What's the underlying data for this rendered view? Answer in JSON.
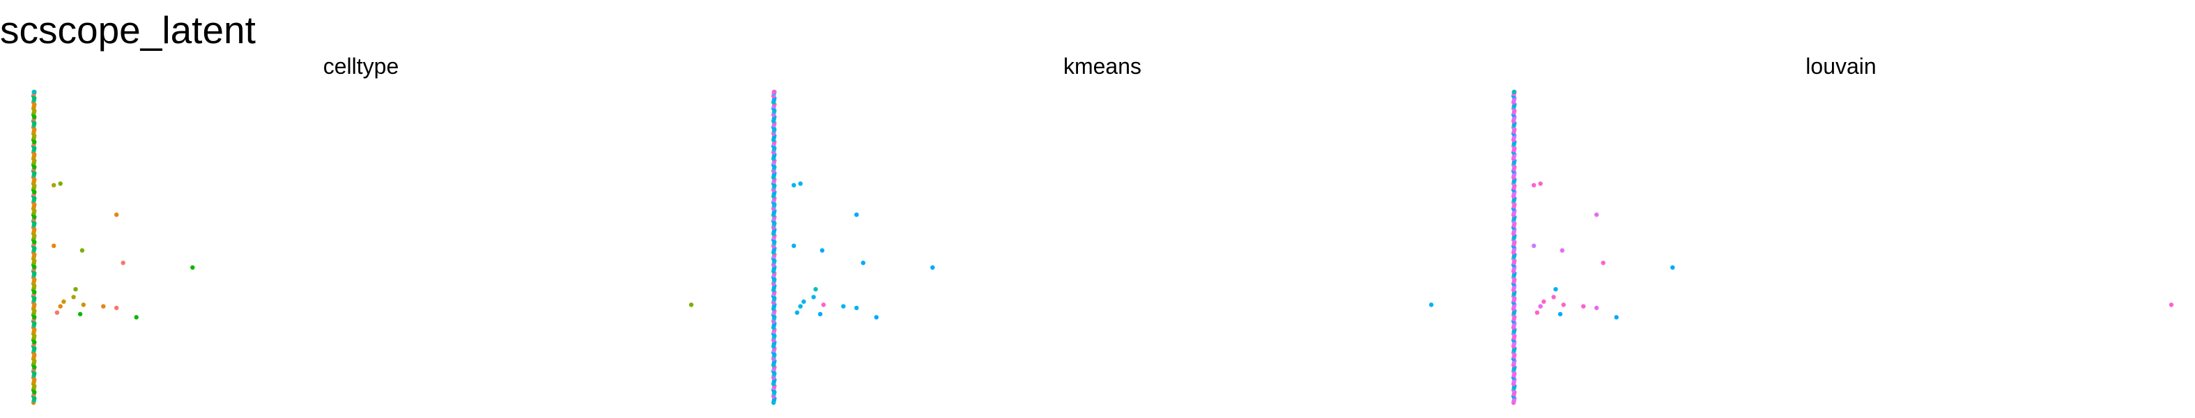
{
  "page_title": "scscope_latent",
  "chart_data": [
    {
      "type": "scatter",
      "title": "celltype",
      "xlabel": "",
      "ylabel": "",
      "xlim": [
        0,
        100
      ],
      "ylim": [
        0,
        100
      ],
      "grid": false,
      "legend": "none",
      "strip": {
        "x": 0.5,
        "y_range": [
          0,
          100
        ],
        "colors": [
          "#E68613",
          "#CD9600",
          "#ABA300",
          "#7CAE00",
          "#0CB702",
          "#F8766D",
          "#00BE67",
          "#00C19A"
        ],
        "top_point": {
          "y": 100,
          "color": "#00BFC4"
        }
      },
      "points": [
        {
          "x": 3.5,
          "y": 70,
          "color": "#ABA300"
        },
        {
          "x": 4.5,
          "y": 70.5,
          "color": "#7CAE00"
        },
        {
          "x": 13,
          "y": 60.5,
          "color": "#E68613"
        },
        {
          "x": 3.5,
          "y": 50.5,
          "color": "#E68613"
        },
        {
          "x": 7.8,
          "y": 49,
          "color": "#7CAE00"
        },
        {
          "x": 14,
          "y": 45,
          "color": "#F8766D"
        },
        {
          "x": 24.5,
          "y": 43.5,
          "color": "#0CB702"
        },
        {
          "x": 6.8,
          "y": 36.5,
          "color": "#7CAE00"
        },
        {
          "x": 6.5,
          "y": 34,
          "color": "#ABA300"
        },
        {
          "x": 5,
          "y": 32.5,
          "color": "#CD9600"
        },
        {
          "x": 4.5,
          "y": 31,
          "color": "#E68613"
        },
        {
          "x": 8,
          "y": 31.5,
          "color": "#CD9600"
        },
        {
          "x": 11,
          "y": 31,
          "color": "#E68613"
        },
        {
          "x": 13,
          "y": 30.5,
          "color": "#F8766D"
        },
        {
          "x": 4,
          "y": 29,
          "color": "#F8766D"
        },
        {
          "x": 7.5,
          "y": 28.5,
          "color": "#0CB702"
        },
        {
          "x": 16,
          "y": 27.5,
          "color": "#0CB702"
        },
        {
          "x": 100,
          "y": 31.5,
          "color": "#7CAE00"
        }
      ]
    },
    {
      "type": "scatter",
      "title": "kmeans",
      "xlabel": "",
      "ylabel": "",
      "xlim": [
        0,
        100
      ],
      "ylim": [
        0,
        100
      ],
      "grid": false,
      "legend": "none",
      "strip": {
        "x": 0.5,
        "y_range": [
          0,
          100
        ],
        "colors": [
          "#00BFC4",
          "#00B4F0",
          "#00A9FF",
          "#C77CFF",
          "#FF61CC",
          "#619CFF"
        ],
        "top_point": {
          "y": 100,
          "color": "#FF61CC"
        }
      },
      "points": [
        {
          "x": 3.5,
          "y": 70,
          "color": "#00B4F0"
        },
        {
          "x": 4.5,
          "y": 70.5,
          "color": "#00B4F0"
        },
        {
          "x": 13,
          "y": 60.5,
          "color": "#00A9FF"
        },
        {
          "x": 3.5,
          "y": 50.5,
          "color": "#00B4F0"
        },
        {
          "x": 7.8,
          "y": 49,
          "color": "#00A9FF"
        },
        {
          "x": 14,
          "y": 45,
          "color": "#00A9FF"
        },
        {
          "x": 24.5,
          "y": 43.5,
          "color": "#00A9FF"
        },
        {
          "x": 6.8,
          "y": 36.5,
          "color": "#00BFC4"
        },
        {
          "x": 6.5,
          "y": 34,
          "color": "#00B4F0"
        },
        {
          "x": 5,
          "y": 32.5,
          "color": "#00B4F0"
        },
        {
          "x": 4.5,
          "y": 31,
          "color": "#00B4F0"
        },
        {
          "x": 8,
          "y": 31.5,
          "color": "#FF61CC"
        },
        {
          "x": 11,
          "y": 31,
          "color": "#00B4F0"
        },
        {
          "x": 13,
          "y": 30.5,
          "color": "#00B4F0"
        },
        {
          "x": 4,
          "y": 29,
          "color": "#00B4F0"
        },
        {
          "x": 7.5,
          "y": 28.5,
          "color": "#00A9FF"
        },
        {
          "x": 16,
          "y": 27.5,
          "color": "#00A9FF"
        },
        {
          "x": 100,
          "y": 31.5,
          "color": "#00B4F0"
        }
      ]
    },
    {
      "type": "scatter",
      "title": "louvain",
      "xlabel": "",
      "ylabel": "",
      "xlim": [
        0,
        100
      ],
      "ylim": [
        0,
        100
      ],
      "grid": false,
      "legend": "none",
      "strip": {
        "x": 0.5,
        "y_range": [
          0,
          100
        ],
        "colors": [
          "#FF61CC",
          "#E76BF3",
          "#C77CFF",
          "#00BFC4",
          "#00A9FF",
          "#F564E3"
        ],
        "top_point": {
          "y": 100,
          "color": "#00BFC4"
        }
      },
      "points": [
        {
          "x": 3.5,
          "y": 70,
          "color": "#FF61CC"
        },
        {
          "x": 4.5,
          "y": 70.5,
          "color": "#FF61CC"
        },
        {
          "x": 13,
          "y": 60.5,
          "color": "#E76BF3"
        },
        {
          "x": 3.5,
          "y": 50.5,
          "color": "#C77CFF"
        },
        {
          "x": 7.8,
          "y": 49,
          "color": "#E76BF3"
        },
        {
          "x": 14,
          "y": 45,
          "color": "#FF61CC"
        },
        {
          "x": 24.5,
          "y": 43.5,
          "color": "#00A9FF"
        },
        {
          "x": 6.8,
          "y": 36.5,
          "color": "#00B4F0"
        },
        {
          "x": 6.5,
          "y": 34,
          "color": "#FF61CC"
        },
        {
          "x": 5,
          "y": 32.5,
          "color": "#FF61CC"
        },
        {
          "x": 4.5,
          "y": 31,
          "color": "#E76BF3"
        },
        {
          "x": 8,
          "y": 31.5,
          "color": "#FF61CC"
        },
        {
          "x": 11,
          "y": 31,
          "color": "#FF61CC"
        },
        {
          "x": 13,
          "y": 30.5,
          "color": "#E76BF3"
        },
        {
          "x": 4,
          "y": 29,
          "color": "#FF61CC"
        },
        {
          "x": 7.5,
          "y": 28.5,
          "color": "#00A9FF"
        },
        {
          "x": 16,
          "y": 27.5,
          "color": "#00A9FF"
        },
        {
          "x": 100,
          "y": 31.5,
          "color": "#FF61CC"
        }
      ]
    }
  ]
}
